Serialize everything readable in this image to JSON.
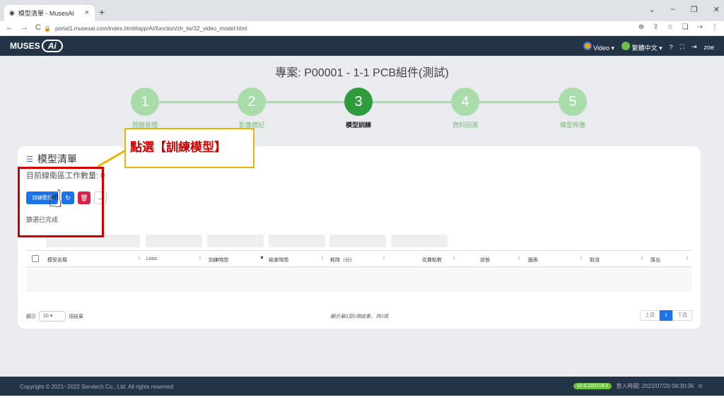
{
  "browser": {
    "tab_title": "模型清單 - MusesAI",
    "tab_close": "×",
    "new_tab": "+",
    "url": "portal1.musesai.com/index.html#app/AI/function/zh_tw/32_video_model.html",
    "win_controls": [
      "⌄",
      "–",
      "❐",
      "✕"
    ],
    "nav": [
      "←",
      "→",
      "C"
    ],
    "addr_icons": [
      "⊕",
      "⇪",
      "☆",
      "❑",
      "⇢",
      "⋮"
    ]
  },
  "app": {
    "logo_text": "MUSES",
    "logo_badge": "Ai",
    "video_label": "Video",
    "lang_label": "繁體中文",
    "user": "zoe"
  },
  "project": {
    "title": "專案: P00001 - 1-1 PCB組件(測試)"
  },
  "steps": [
    {
      "num": "1",
      "label": "問題管理",
      "active": false
    },
    {
      "num": "2",
      "label": "影像標記",
      "active": false
    },
    {
      "num": "3",
      "label": "模型訓練",
      "active": true
    },
    {
      "num": "4",
      "label": "資料回測",
      "active": false
    },
    {
      "num": "5",
      "label": "模型佈署",
      "active": false
    }
  ],
  "card": {
    "title": "模型清單",
    "queue_label": "目前線衛區工作數量: 0",
    "train_btn": "訓練模型",
    "refresh_btn": "↻",
    "delete_btn": "🗑",
    "more_btn": "↔",
    "filter_label": "篩選已完成"
  },
  "table": {
    "columns": [
      "模型名稱",
      "Loss",
      "訓練時間",
      "結束時間",
      "耗時（分）",
      "花費點數",
      "狀態",
      "圖表",
      "取消",
      "匯出"
    ]
  },
  "footer_table": {
    "show_label": "顯示",
    "page_size": "10",
    "records_label": "項結果",
    "info": "顯示第0至0項結果，共0項",
    "prev": "上頁",
    "current_page": "1",
    "next": "下頁"
  },
  "annotation": {
    "text": "點選【訓練模型】"
  },
  "page_footer": {
    "copyright": "Copyright © 2021~2022 Servtech Co., Ltd. All rights reserved",
    "version": "v2.0.220718.0",
    "login_time": "登入時間: 2022/07/20 08:30:36"
  },
  "colors": {
    "appbar": "#243447",
    "accent": "#1a73e8",
    "step_active": "#2e9b3c",
    "step_inactive": "#a8dca8",
    "annot_red": "#d00000"
  }
}
